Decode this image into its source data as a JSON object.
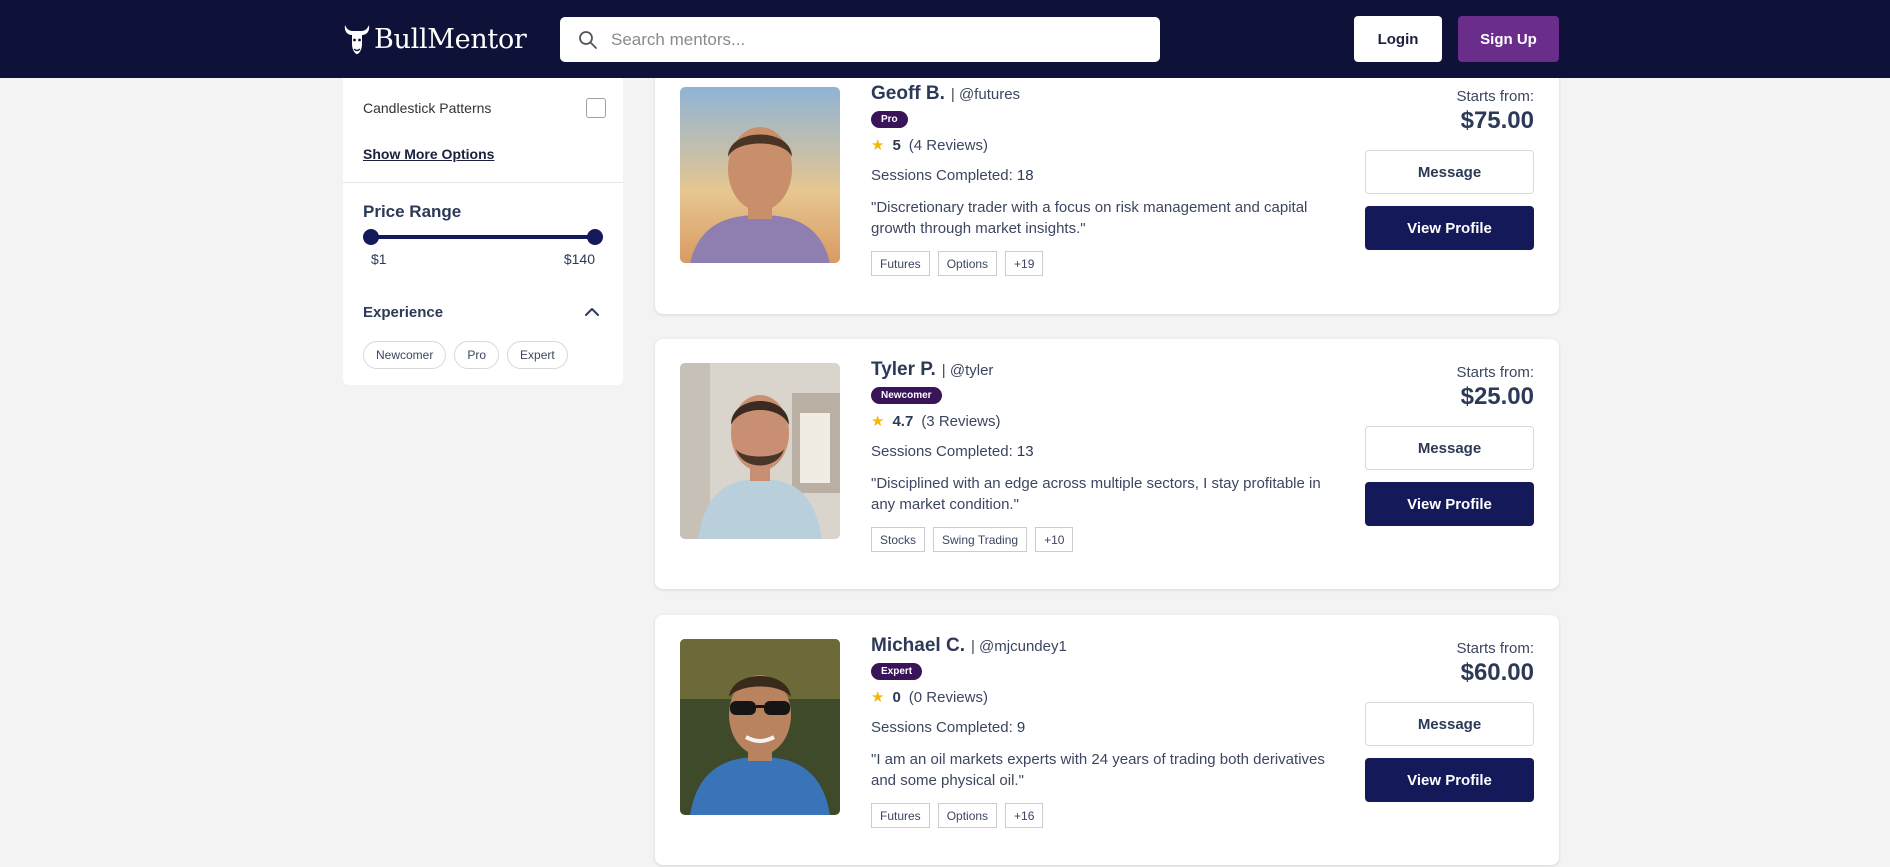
{
  "header": {
    "brand": "BullMentor",
    "search_placeholder": "Search mentors...",
    "login_label": "Login",
    "signup_label": "Sign Up",
    "colors": {
      "bg": "#0e1238",
      "signup": "#6a2d8c"
    }
  },
  "sidebar": {
    "filter_option": {
      "label": "Candlestick Patterns",
      "checked": false
    },
    "show_more_label": "Show More Options",
    "price_range": {
      "title": "Price Range",
      "min_label": "$1",
      "max_label": "$140",
      "min_value": 1,
      "max_value": 140
    },
    "experience": {
      "title": "Experience",
      "expanded": true,
      "options": [
        "Newcomer",
        "Pro",
        "Expert"
      ]
    }
  },
  "mentors": [
    {
      "name": "Geoff B.",
      "handle": "| @futures",
      "level": "Pro",
      "rating": "5",
      "reviews": "(4 Reviews)",
      "sessions_label": "Sessions Completed:",
      "sessions": "18",
      "quote": "\"Discretionary trader with a focus on risk management and capital growth through market insights.\"",
      "tags": [
        "Futures",
        "Options",
        "+19"
      ],
      "starts_label": "Starts from:",
      "price": "$75.00",
      "message_label": "Message",
      "view_label": "View Profile"
    },
    {
      "name": "Tyler P.",
      "handle": "| @tyler",
      "level": "Newcomer",
      "rating": "4.7",
      "reviews": "(3 Reviews)",
      "sessions_label": "Sessions Completed:",
      "sessions": "13",
      "quote": "\"Disciplined with an edge across multiple sectors, I stay profitable in any market condition.\"",
      "tags": [
        "Stocks",
        "Swing Trading",
        "+10"
      ],
      "starts_label": "Starts from:",
      "price": "$25.00",
      "message_label": "Message",
      "view_label": "View Profile"
    },
    {
      "name": "Michael C.",
      "handle": "| @mjcundey1",
      "level": "Expert",
      "rating": "0",
      "reviews": "(0 Reviews)",
      "sessions_label": "Sessions Completed:",
      "sessions": "9",
      "quote": "\"I am an oil markets experts with 24 years of trading both derivatives and some physical oil.\"",
      "tags": [
        "Futures",
        "Options",
        "+16"
      ],
      "starts_label": "Starts from:",
      "price": "$60.00",
      "message_label": "Message",
      "view_label": "View Profile"
    }
  ]
}
